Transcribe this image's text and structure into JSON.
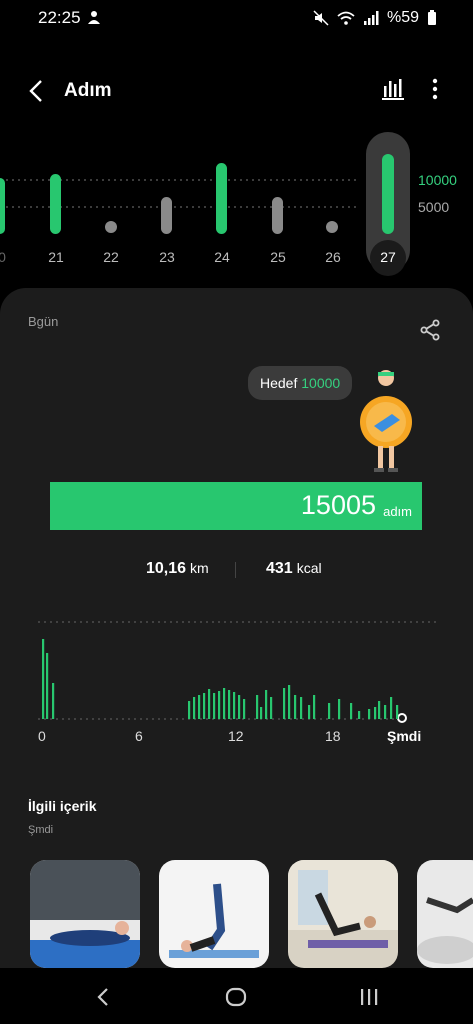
{
  "status": {
    "time": "22:25",
    "battery": "%59"
  },
  "header": {
    "title": "Adım"
  },
  "week": {
    "days": [
      "0",
      "21",
      "22",
      "23",
      "24",
      "25",
      "26",
      "27"
    ],
    "selected": "27",
    "goal_lines": [
      "10000",
      "5000"
    ]
  },
  "today": {
    "label": "Bgün",
    "goal_label": "Hedef",
    "goal_value": "10000",
    "steps": "15005",
    "steps_unit": "adım",
    "distance": "10,16",
    "distance_unit": "km",
    "calories": "431",
    "calories_unit": "kcal"
  },
  "hourly": {
    "axis": [
      "0",
      "6",
      "12",
      "18",
      "Şmdi"
    ]
  },
  "related": {
    "title": "İlgili içerik",
    "subtitle": "Şmdi"
  },
  "colors": {
    "accent": "#28c76f",
    "card": "#1c1c1c"
  }
}
